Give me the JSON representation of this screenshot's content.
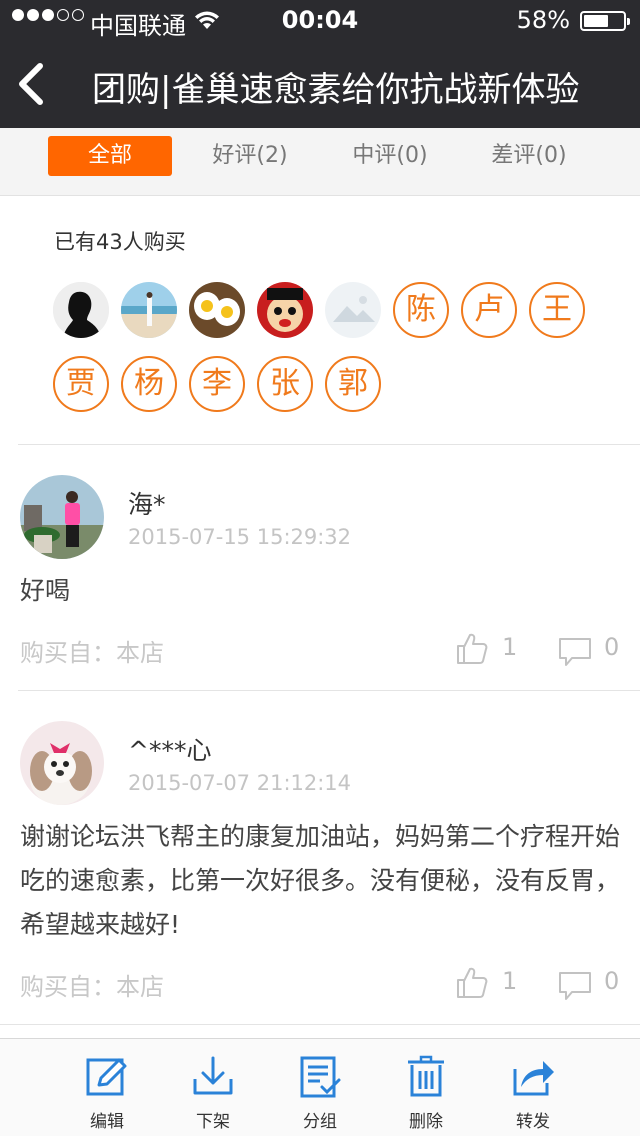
{
  "status": {
    "carrier": "中国联通",
    "time": "00:04",
    "battery": "58%"
  },
  "nav": {
    "title": "团购|雀巢速愈素给你抗战新体验"
  },
  "tabs": [
    {
      "label": "全部"
    },
    {
      "label": "好评(2)"
    },
    {
      "label": "中评(0)"
    },
    {
      "label": "差评(0)"
    }
  ],
  "buyers": {
    "count_text": "已有43人购买",
    "names": [
      "陈",
      "卢",
      "王",
      "贾",
      "杨",
      "李",
      "张",
      "郭"
    ]
  },
  "reviews": [
    {
      "name": "海*",
      "date": "2015-07-15 15:29:32",
      "text": "好喝",
      "from": "购买自：本店",
      "likes": "1",
      "comments": "0"
    },
    {
      "name": "^***心",
      "date": "2015-07-07 21:12:14",
      "text": "谢谢论坛洪飞帮主的康复加油站，妈妈第二个疗程开始吃的速愈素，比第一次好很多。没有便秘，没有反胃，希望越来越好!",
      "from": "购买自：本店",
      "likes": "1",
      "comments": "0"
    }
  ],
  "toolbar": {
    "edit": "编辑",
    "unlist": "下架",
    "group": "分组",
    "delete": "删除",
    "share": "转发"
  },
  "colors": {
    "accent": "#ff6600",
    "name_circle": "#f07a1c",
    "toolbar_icon": "#2a82d8",
    "nav_bg": "#2b2b2f"
  }
}
